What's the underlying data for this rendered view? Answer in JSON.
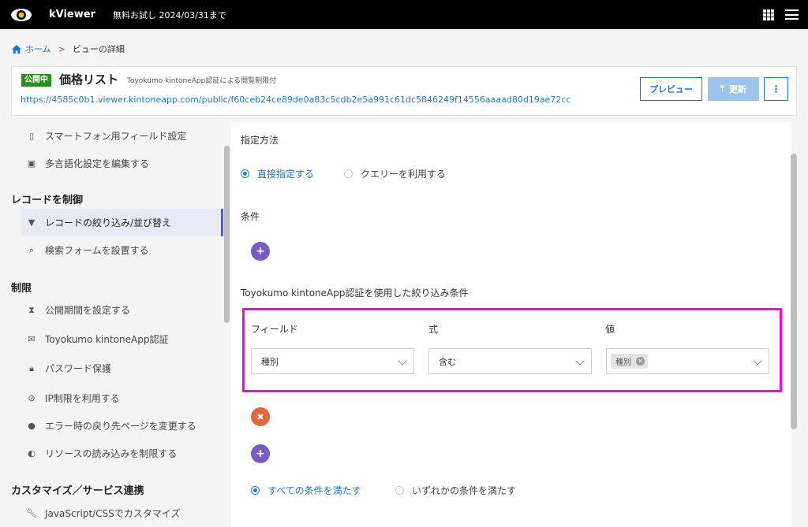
{
  "topbar": {
    "app_name": "kViewer",
    "trial_text": "無料お試し 2024/03/31まで"
  },
  "breadcrumb": {
    "home": "ホーム",
    "separator": ">",
    "current": "ビューの詳細"
  },
  "header": {
    "badge": "公開中",
    "title": "価格リスト",
    "subtitle": "Toyokumo kintoneApp認証による閲覧制限付",
    "url": "https://4585c0b1.viewer.kintoneapp.com/public/f60ceb24ce89de0a83c5cdb2e5a991c61dc5846249f14556aaaad80d19ae72cc",
    "preview_label": "プレビュー",
    "update_label": "更新",
    "more_label": "⋮"
  },
  "sidebar": {
    "items_top": [
      {
        "label": "スマートフォン用フィールド設定",
        "icon": "smartphone-icon"
      },
      {
        "label": "多言語化設定を編集する",
        "icon": "language-icon"
      }
    ],
    "group_record": "レコードを制御",
    "items_record": [
      {
        "label": "レコードの絞り込み/並び替え",
        "icon": "filter-icon"
      },
      {
        "label": "検索フォームを設置する",
        "icon": "search-icon"
      }
    ],
    "group_limit": "制限",
    "items_limit": [
      {
        "label": "公開期間を設定する",
        "icon": "hourglass-icon"
      },
      {
        "label": "Toyokumo kintoneApp認証",
        "icon": "mail-icon"
      },
      {
        "label": "パスワード保護",
        "icon": "lock-icon"
      },
      {
        "label": "IP制限を利用する",
        "icon": "ban-icon"
      },
      {
        "label": "エラー時の戻り先ページを変更する",
        "icon": "alert-icon"
      },
      {
        "label": "リソースの読み込みを制限する",
        "icon": "shield-icon"
      }
    ],
    "group_custom": "カスタマイズ／サービス連携",
    "items_custom": [
      {
        "label": "JavaScript/CSSでカスタマイズ",
        "icon": "wrench-icon"
      }
    ]
  },
  "main": {
    "method_label": "指定方法",
    "radio_direct": "直接指定する",
    "radio_query": "クエリーを利用する",
    "condition_label": "条件",
    "auth_condition_label": "Toyokumo kintoneApp認証を使用した絞り込み条件",
    "col_field": "フィールド",
    "col_expr": "式",
    "col_value": "値",
    "field_value": "種別",
    "expr_value": "含む",
    "value_chip": "種別",
    "radio_all": "すべての条件を満たす",
    "radio_any": "いずれかの条件を満たす"
  }
}
